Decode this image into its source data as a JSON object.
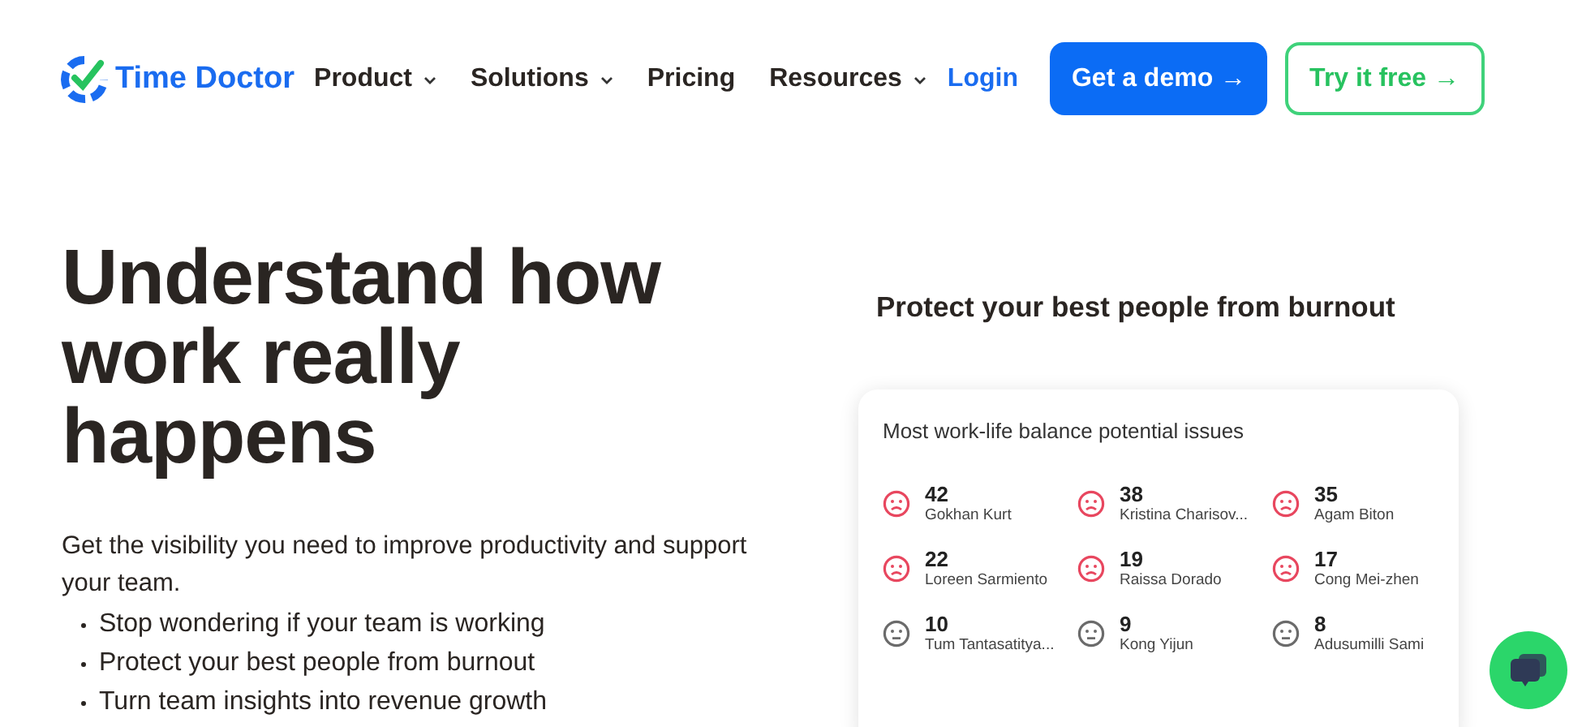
{
  "brand": "Time Doctor",
  "nav": [
    {
      "label": "Product",
      "dropdown": true
    },
    {
      "label": "Solutions",
      "dropdown": true
    },
    {
      "label": "Pricing",
      "dropdown": false
    },
    {
      "label": "Resources",
      "dropdown": true
    }
  ],
  "login": "Login",
  "buttons": [
    {
      "label": "Get a demo →",
      "kind": "primary"
    },
    {
      "label": "Try it free →",
      "kind": "outline"
    }
  ],
  "hero": {
    "title": "Understand how work really happens",
    "subtitle": "Get the visibility you need to improve productivity and support your team.",
    "bullets": [
      "Stop wondering if your team is working",
      "Protect your best people from burnout",
      "Turn team insights into revenue growth"
    ]
  },
  "panel": {
    "title": "Protect your best people from burnout",
    "card_title": "Most work-life balance potential issues",
    "people": [
      {
        "score": "42",
        "name": "Gokhan Kurt",
        "kind": "sad"
      },
      {
        "score": "38",
        "name": "Kristina Charisov...",
        "kind": "sad"
      },
      {
        "score": "35",
        "name": "Agam Biton",
        "kind": "sad"
      },
      {
        "score": "22",
        "name": "Loreen Sarmiento",
        "kind": "sad"
      },
      {
        "score": "19",
        "name": "Raissa Dorado",
        "kind": "sad"
      },
      {
        "score": "17",
        "name": "Cong Mei-zhen",
        "kind": "sad"
      },
      {
        "score": "10",
        "name": "Tum Tantasatitya...",
        "kind": "neutral"
      },
      {
        "score": "9",
        "name": "Kong Yijun",
        "kind": "neutral"
      },
      {
        "score": "8",
        "name": "Adusumilli Sami",
        "kind": "neutral"
      }
    ]
  }
}
